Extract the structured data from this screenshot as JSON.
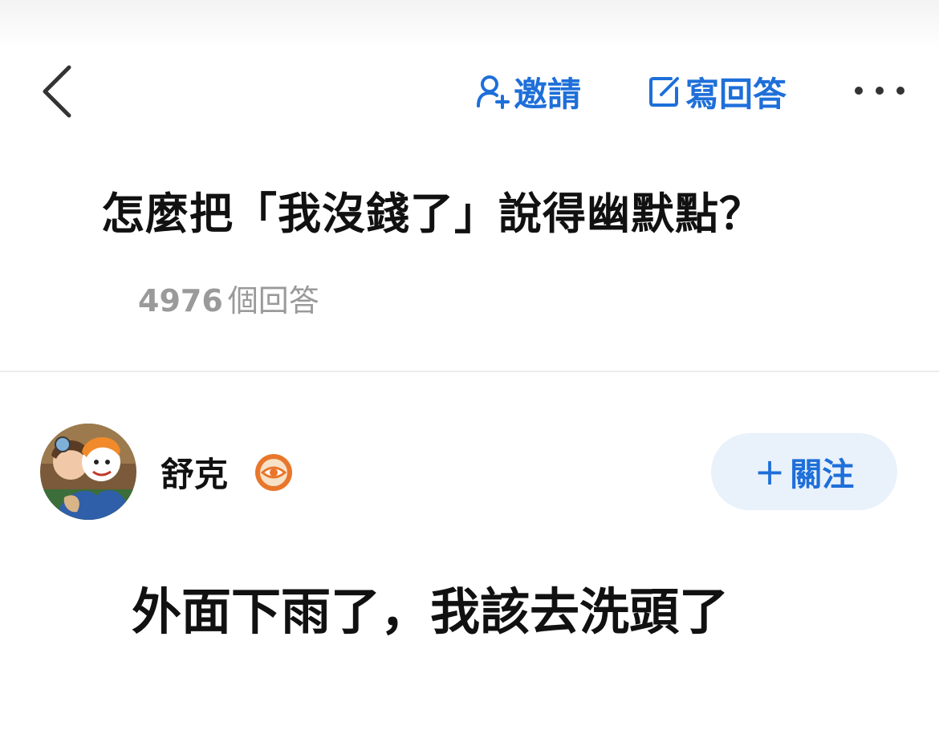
{
  "nav": {
    "back_icon": "chevron-left-icon",
    "invite_icon": "user-plus-icon",
    "invite_label": "邀請",
    "write_icon": "edit-icon",
    "write_label": "寫回答",
    "more_icon": "more-dots-icon"
  },
  "question": {
    "title": "怎麼把「我沒錢了」說得幽默點？",
    "answer_count": "4976",
    "answer_count_unit": "個回答"
  },
  "answer": {
    "author_name": "舒克",
    "badge_icon": "eye-badge-icon",
    "follow_plus": "+",
    "follow_label": "關注",
    "content": "外面下雨了，我該去洗頭了"
  },
  "colors": {
    "accent": "#1e6fd9",
    "follow_bg": "#e9f1fb",
    "muted_text": "#9a9a9a",
    "badge_orange": "#e9762b"
  }
}
